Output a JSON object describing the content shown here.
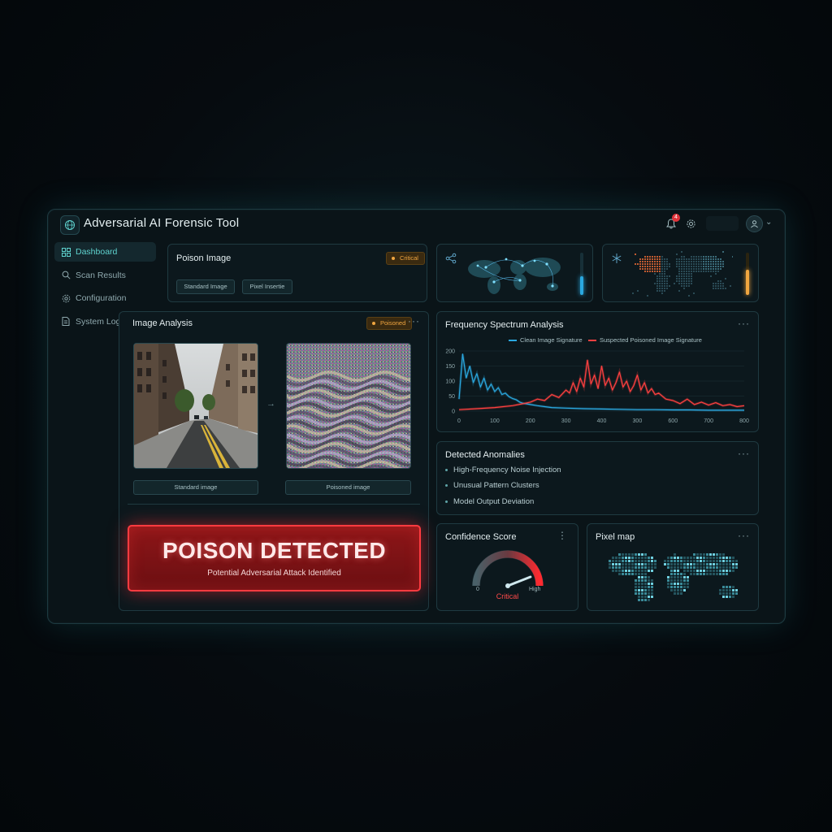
{
  "app": {
    "title": "Adversarial AI Forensic Tool",
    "notification_count": "4",
    "accent": "#5fd3cf"
  },
  "sidebar": {
    "items": [
      {
        "label": "Dashboard",
        "icon": "grid-icon",
        "active": true
      },
      {
        "label": "Scan Results",
        "icon": "search-icon",
        "active": false
      },
      {
        "label": "Configuration",
        "icon": "gear-icon",
        "active": false
      },
      {
        "label": "System Logs",
        "icon": "file-icon",
        "active": false
      }
    ]
  },
  "poison_panel": {
    "title": "Poison Image",
    "badge": "Critical",
    "chips": [
      "Standard Image",
      "Pixel Insertie"
    ]
  },
  "mini_maps": [
    {
      "icon": "share-icon",
      "level_color": "#2aa8e0",
      "level": 0.45
    },
    {
      "icon": "snowflake-icon",
      "level_color": "#f0a640",
      "level": 0.6
    }
  ],
  "image_analysis": {
    "title": "Image Analysis",
    "badge": "Poisoned",
    "standard_label": "Standard image",
    "poisoned_label": "Poisoned image",
    "alert_title": "POISON DETECTED",
    "alert_subtitle": "Potential Adversarial Attack Identified"
  },
  "frequency": {
    "title": "Frequency Spectrum Analysis",
    "legend_clean": "Clean Image Signature",
    "legend_poison": "Suspected Poisoned Image Signature"
  },
  "chart_data": {
    "type": "line",
    "title": "Frequency Spectrum Analysis",
    "xlim": [
      0,
      800
    ],
    "ylim": [
      0,
      200
    ],
    "x_ticks": [
      "0",
      "100",
      "200",
      "300",
      "400",
      "300",
      "600",
      "700",
      "800"
    ],
    "y_ticks": [
      "200",
      "150",
      "100",
      "50",
      "0"
    ],
    "series": [
      {
        "name": "Clean Image Signature",
        "color": "#2aa8e0",
        "x": [
          0,
          10,
          20,
          30,
          40,
          50,
          60,
          70,
          80,
          90,
          100,
          110,
          120,
          130,
          140,
          150,
          160,
          170,
          180,
          200,
          220,
          240,
          260,
          300,
          350,
          400,
          450,
          500,
          550,
          600,
          650,
          700,
          750,
          800
        ],
        "y": [
          40,
          190,
          110,
          150,
          95,
          125,
          80,
          110,
          70,
          90,
          65,
          78,
          55,
          60,
          48,
          42,
          38,
          30,
          26,
          22,
          18,
          15,
          12,
          10,
          8,
          7,
          6,
          5,
          5,
          4,
          4,
          3,
          3,
          3
        ]
      },
      {
        "name": "Suspected Poisoned Image Signature",
        "color": "#ff4040",
        "x": [
          0,
          50,
          100,
          150,
          180,
          200,
          220,
          240,
          260,
          280,
          300,
          310,
          320,
          330,
          340,
          350,
          360,
          370,
          380,
          390,
          400,
          410,
          420,
          430,
          440,
          450,
          460,
          470,
          480,
          490,
          500,
          510,
          520,
          530,
          540,
          550,
          560,
          580,
          600,
          620,
          640,
          660,
          680,
          700,
          720,
          740,
          760,
          780,
          800
        ],
        "y": [
          5,
          8,
          12,
          18,
          25,
          30,
          40,
          35,
          55,
          45,
          70,
          60,
          95,
          65,
          110,
          80,
          170,
          90,
          120,
          75,
          150,
          85,
          110,
          70,
          95,
          130,
          80,
          100,
          65,
          85,
          120,
          70,
          95,
          60,
          75,
          55,
          60,
          40,
          35,
          25,
          40,
          22,
          30,
          20,
          28,
          18,
          22,
          15,
          18
        ]
      }
    ]
  },
  "anomalies": {
    "title": "Detected Anomalies",
    "items": [
      "High-Frequency Noise Injection",
      "Unusual Pattern Clusters",
      "Model Output Deviation"
    ]
  },
  "confidence": {
    "title": "Confidence Score",
    "min_label": "0",
    "max_label": "High",
    "status": "Critical",
    "value": 0.88
  },
  "pixel_map": {
    "title": "Pixel map"
  }
}
